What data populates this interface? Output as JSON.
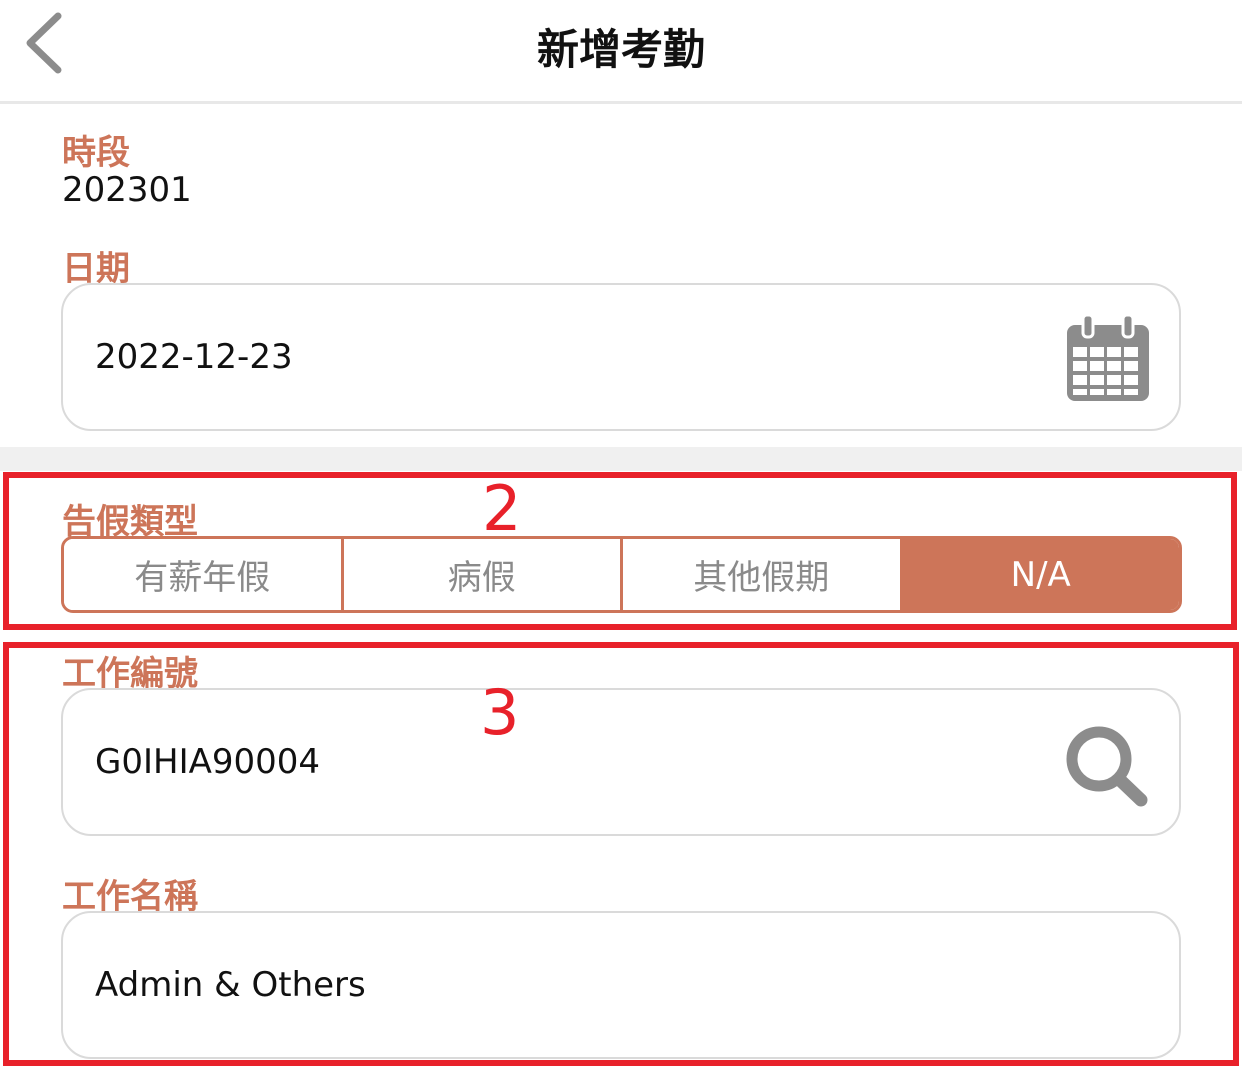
{
  "header": {
    "title": "新增考勤",
    "back_icon": "chevron-left-icon"
  },
  "period": {
    "label": "時段",
    "value": "202301"
  },
  "date": {
    "label": "日期",
    "value": "2022-12-23",
    "icon": "calendar-icon"
  },
  "leave_type": {
    "label": "告假類型",
    "options": [
      "有薪年假",
      "病假",
      "其他假期",
      "N/A"
    ],
    "selected": "N/A"
  },
  "job_number": {
    "label": "工作編號",
    "value": "G0IHIA90004",
    "icon": "search-icon"
  },
  "job_name": {
    "label": "工作名稱",
    "value": "Admin & Others"
  },
  "annotations": {
    "box2": "2",
    "box3": "3"
  },
  "colors": {
    "accent": "#cd7559",
    "annotation": "#e8212a",
    "icon_gray": "#8c8c8c",
    "field_border": "#dadada"
  }
}
